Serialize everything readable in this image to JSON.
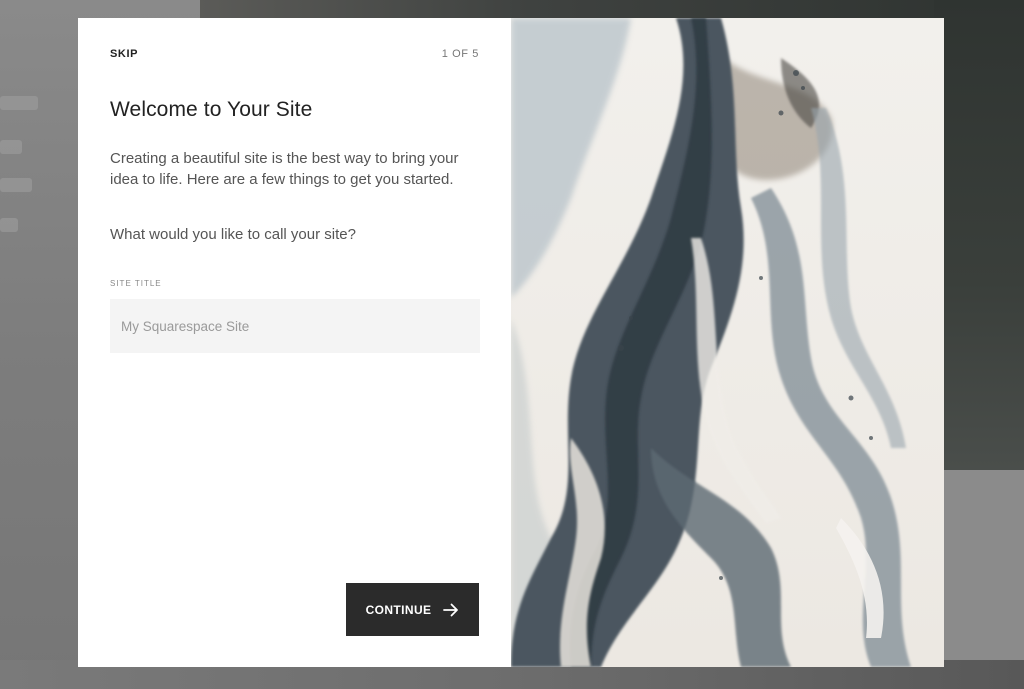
{
  "modal": {
    "skip_label": "SKIP",
    "step_counter": "1 OF 5",
    "title": "Welcome to Your Site",
    "description": "Creating a beautiful site is the best way to bring your idea to life. Here are a few things to get you started.",
    "question": "What would you like to call your site?",
    "field_label": "SITE TITLE",
    "site_title_placeholder": "My Squarespace Site",
    "site_title_value": "",
    "continue_label": "CONTINUE",
    "continue_icon": "arrow-right-icon"
  },
  "hero_image": {
    "description": "abstract marble fluid art",
    "colors": [
      "#f1efea",
      "#4e5a63",
      "#8e9aa3",
      "#c9bfb1"
    ]
  }
}
